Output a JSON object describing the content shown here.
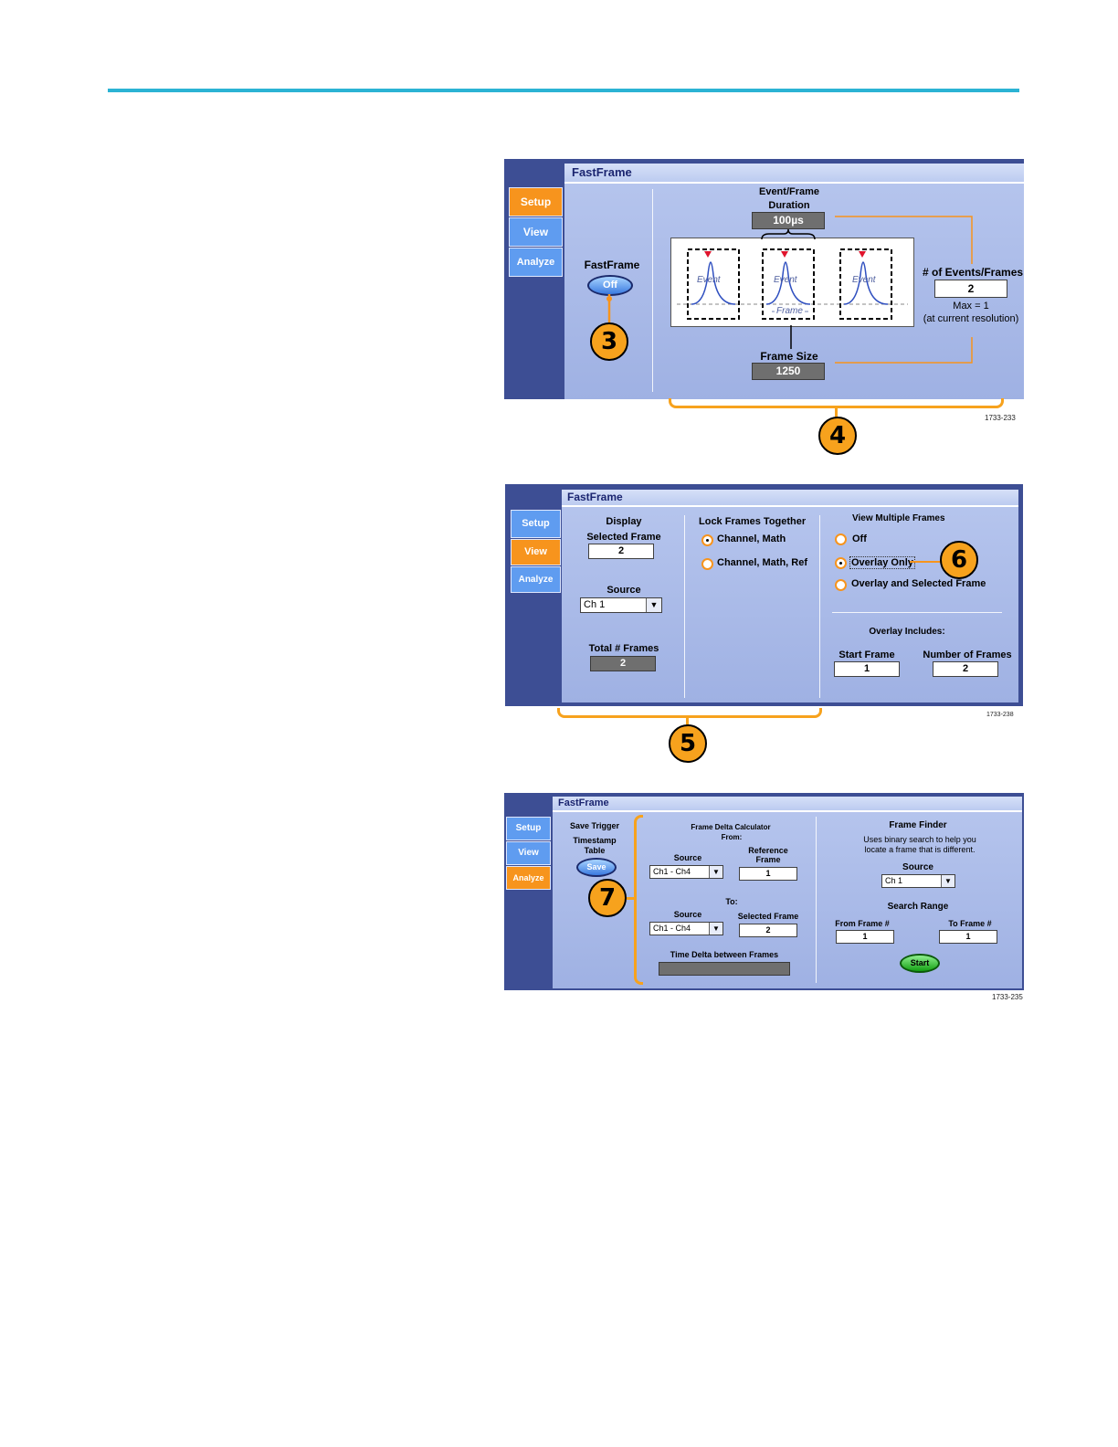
{
  "colors": {
    "accent_line": "#2bb3d4",
    "tab_active": "#f7941d",
    "tab_inactive": "#5f9cf0",
    "callout": "#f7a21d"
  },
  "tabs": {
    "setup": "Setup",
    "view": "View",
    "analyze": "Analyze"
  },
  "setup": {
    "title": "FastFrame",
    "fastframe_label": "FastFrame",
    "fastframe_button": "Off",
    "duration_label_1": "Event/Frame",
    "duration_label_2": "Duration",
    "duration_value": "100µs",
    "event_label": "Event",
    "frame_label": "Frame",
    "events_frames_label": "# of Events/Frames",
    "events_frames_value": "2",
    "max_note": "Max = 1",
    "resolution_note": "(at current resolution)",
    "frame_size_label": "Frame Size",
    "frame_size_value": "1250",
    "figure_id": "1733-233",
    "callout_fastframe": "3",
    "callout_bracket": "4"
  },
  "view": {
    "title": "FastFrame",
    "display_label": "Display",
    "selected_frame_label": "Selected Frame",
    "selected_frame_value": "2",
    "source_label": "Source",
    "source_value": "Ch 1",
    "total_frames_label": "Total # Frames",
    "total_frames_value": "2",
    "lock_label": "Lock Frames Together",
    "lock_opt1": "Channel, Math",
    "lock_opt2": "Channel, Math, Ref",
    "multiple_label": "View Multiple Frames",
    "multiple_off": "Off",
    "multiple_overlay": "Overlay Only",
    "multiple_overlay_selected": "Overlay and Selected Frame",
    "overlay_includes": "Overlay Includes:",
    "start_frame_label": "Start Frame",
    "start_frame_value": "1",
    "number_frames_label": "Number of Frames",
    "number_frames_value": "2",
    "figure_id": "1733-238",
    "callout_bracket": "5",
    "callout_overlay": "6"
  },
  "analyze": {
    "title": "FastFrame",
    "save_trigger_1": "Save Trigger",
    "save_trigger_2": "Timestamp",
    "save_trigger_3": "Table",
    "save_button": "Save",
    "calc_label": "Frame Delta Calculator",
    "from_label": "From:",
    "source_label_from": "Source",
    "source_from_value": "Ch1 - Ch4",
    "ref_frame_label_1": "Reference",
    "ref_frame_label_2": "Frame",
    "ref_frame_value": "1",
    "to_label": "To:",
    "source_label_to": "Source",
    "source_to_value": "Ch1 - Ch4",
    "selected_frame_label": "Selected Frame",
    "selected_frame_value": "2",
    "time_delta_label": "Time Delta between Frames",
    "time_delta_value": "",
    "finder_label": "Frame Finder",
    "finder_desc_1": "Uses binary search to help you",
    "finder_desc_2": "locate a frame that is different.",
    "finder_source_label": "Source",
    "finder_source_value": "Ch 1",
    "search_range_label": "Search Range",
    "from_frame_label": "From Frame #",
    "from_frame_value": "1",
    "to_frame_label": "To Frame #",
    "to_frame_value": "1",
    "start_button": "Start",
    "figure_id": "1733-235",
    "callout_bracket": "7"
  }
}
